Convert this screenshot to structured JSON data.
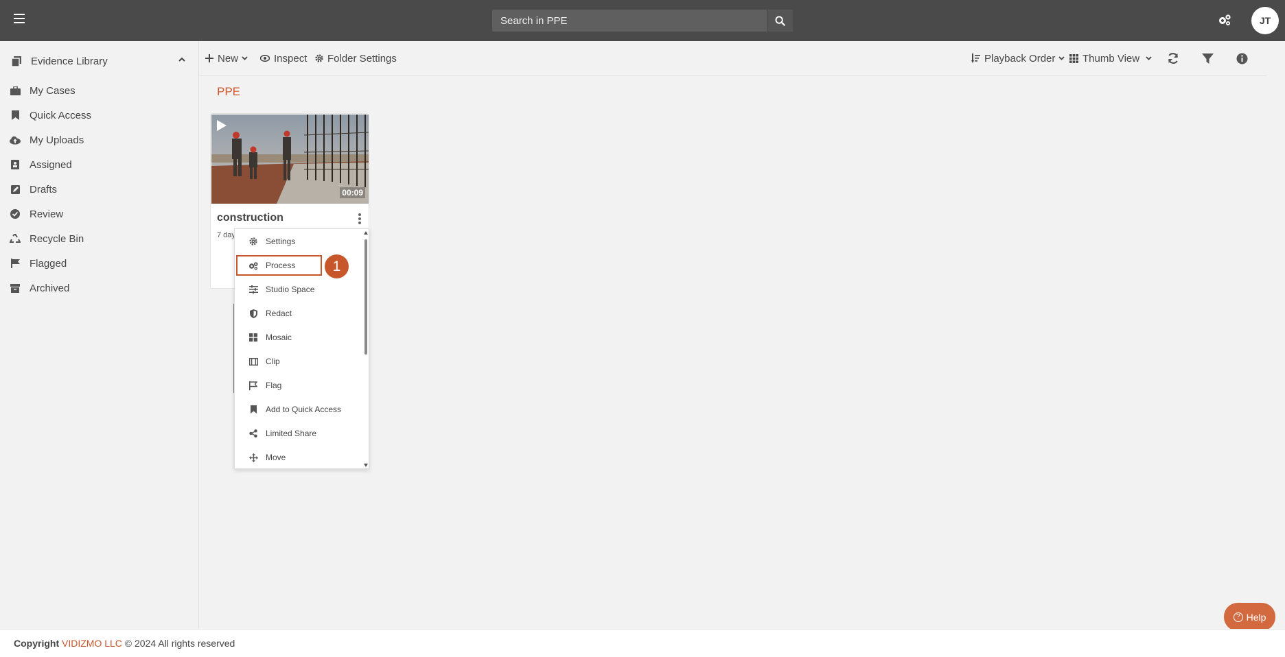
{
  "topbar": {
    "search_placeholder": "Search in PPE",
    "avatar_initials": "JT"
  },
  "sidebar": {
    "library_label": "Evidence Library",
    "items": [
      {
        "label": "My Cases",
        "icon": "briefcase-icon"
      },
      {
        "label": "Quick Access",
        "icon": "bookmark-icon"
      },
      {
        "label": "My Uploads",
        "icon": "cloud-upload-icon"
      },
      {
        "label": "Assigned",
        "icon": "assigned-icon"
      },
      {
        "label": "Drafts",
        "icon": "edit-icon"
      },
      {
        "label": "Review",
        "icon": "check-circle-icon"
      },
      {
        "label": "Recycle Bin",
        "icon": "recycle-icon"
      },
      {
        "label": "Flagged",
        "icon": "flag-icon"
      },
      {
        "label": "Archived",
        "icon": "archive-icon"
      }
    ]
  },
  "toolbar": {
    "new_label": "New",
    "inspect_label": "Inspect",
    "folder_settings_label": "Folder Settings",
    "playback_order_label": "Playback Order",
    "thumb_view_label": "Thumb View"
  },
  "main": {
    "folder_title": "PPE"
  },
  "card": {
    "title": "construction",
    "duration": "00:09",
    "meta": "7 day"
  },
  "context_menu": {
    "items": [
      {
        "label": "Settings",
        "icon": "gear-icon"
      },
      {
        "label": "Process",
        "icon": "gears-icon"
      },
      {
        "label": "Studio Space",
        "icon": "sliders-icon"
      },
      {
        "label": "Redact",
        "icon": "shield-icon"
      },
      {
        "label": "Mosaic",
        "icon": "grid-icon"
      },
      {
        "label": "Clip",
        "icon": "film-icon"
      },
      {
        "label": "Flag",
        "icon": "flag-outline-icon"
      },
      {
        "label": "Add to Quick Access",
        "icon": "bookmark-icon"
      },
      {
        "label": "Limited Share",
        "icon": "share-icon"
      },
      {
        "label": "Move",
        "icon": "move-icon"
      }
    ],
    "highlighted": "Process"
  },
  "step_badge": "1",
  "help_label": "Help",
  "footer": {
    "copyright": "Copyright",
    "brand": "VIDIZMO LLC",
    "rest": "© 2024 All rights reserved"
  },
  "colors": {
    "accent": "#c8562b",
    "topbar": "#4a4a4a",
    "help": "#d3693e"
  }
}
